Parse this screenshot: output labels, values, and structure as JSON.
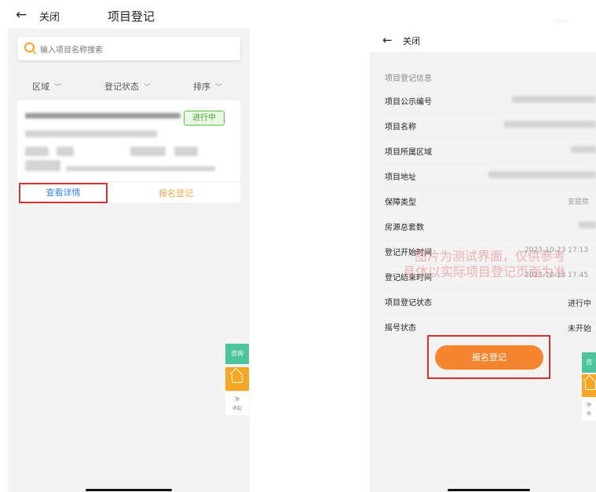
{
  "list_screen": {
    "back_icon": "←",
    "close_label": "关闭",
    "title": "项目登记",
    "search": {
      "icon": "search-icon",
      "placeholder": "输入项目名称搜索"
    },
    "filters": [
      {
        "label": "区域"
      },
      {
        "label": "登记状态"
      },
      {
        "label": "排序"
      }
    ],
    "card": {
      "status": "进行中",
      "view_details": "查看详情",
      "register": "报名登记"
    },
    "float_buttons": {
      "consult": "咨询",
      "home_icon": "home-icon",
      "collapse": "收起",
      "collapse_icon": "»"
    }
  },
  "detail_screen": {
    "status_dots": "....",
    "back_icon": "←",
    "close_label": "关闭",
    "section_title": "项目登记信息",
    "rows": [
      {
        "label": "项目公示编号",
        "value": ""
      },
      {
        "label": "项目名称",
        "value": ""
      },
      {
        "label": "项目所属区域",
        "value": ""
      },
      {
        "label": "项目地址",
        "value": ""
      },
      {
        "label": "保障类型",
        "value": "安居房"
      },
      {
        "label": "房源总套数",
        "value": ""
      },
      {
        "label": "登记开始时间",
        "value": "2023-10-23 17:13"
      },
      {
        "label": "登记结束时间",
        "value": "2023-10-23 17:45"
      },
      {
        "label": "项目登记状态",
        "value": "进行中"
      },
      {
        "label": "摇号状态",
        "value": "未开始"
      }
    ],
    "watermark_line1": "图片为测试界面，仅供参考",
    "watermark_line2": "具体以实际项目登记页面为准",
    "register_button": "报名登记",
    "float_buttons": {
      "consult": "咨",
      "home_icon": "home-icon",
      "collapse_icon": "»",
      "collapse": "收"
    }
  },
  "colors": {
    "accent_orange": "#f5862f",
    "status_green": "#56c23f",
    "link_blue": "#3a86e8",
    "highlight_red": "#d83030",
    "fab_green": "#4cc49e",
    "fab_orange": "#f5a623"
  }
}
